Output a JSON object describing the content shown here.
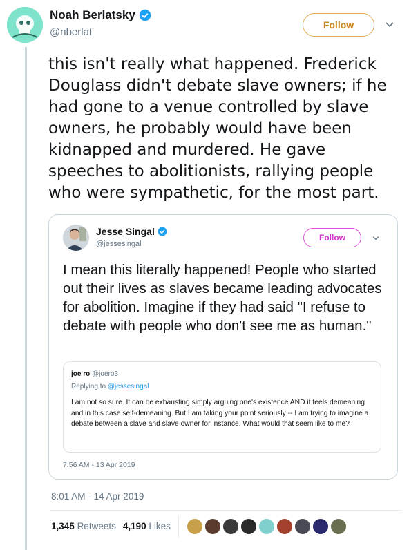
{
  "tweet": {
    "name": "Noah Berlatsky",
    "handle": "@nberlat",
    "follow_label": "Follow",
    "text": "this isn't really what happened. Frederick Douglass didn't debate slave owners; if he had gone to a venue controlled by slave owners, he probably would have been kidnapped and murdered. He gave speeches to abolitionists, rallying people who were sympathetic, for the most part.",
    "timestamp": "8:01 AM - 14 Apr 2019",
    "retweets_count": "1,345",
    "retweets_label": "Retweets",
    "likes_count": "4,190",
    "likes_label": "Likes"
  },
  "quoted": {
    "name": "Jesse Singal",
    "handle": "@jessesingal",
    "follow_label": "Follow",
    "text": "I mean this literally happened! People who started out their lives as slaves became leading advocates for abolition. Imagine if they had said \"I refuse to debate with people who don't see me as human.\"",
    "timestamp": "7:56 AM - 13 Apr 2019",
    "reply": {
      "name": "joe ro",
      "handle": "@joero3",
      "replying_prefix": "Replying to",
      "replying_to": "@jessesingal",
      "text": "I am not so sure. It can be exhausting simply arguing one's existence AND it feels demeaning and in this case self-demeaning. But I am taking your point seriously -- I am trying to imagine a debate between a slave and slave owner for instance. What would that seem like to me?"
    }
  },
  "colors": {
    "verified": "#1da1f2",
    "follow_main": "#c9841d",
    "follow_quoted": "#d035c8",
    "link": "#1b95e0",
    "muted": "#657786"
  },
  "likers": [
    {
      "color": "#c8a04a"
    },
    {
      "color": "#5a3b2e"
    },
    {
      "color": "#3a3a3a"
    },
    {
      "color": "#2b2b2b"
    },
    {
      "color": "#7fd0cf"
    },
    {
      "color": "#a3412e"
    },
    {
      "color": "#4a4a55"
    },
    {
      "color": "#2a2a6e"
    },
    {
      "color": "#6b6f52"
    }
  ]
}
